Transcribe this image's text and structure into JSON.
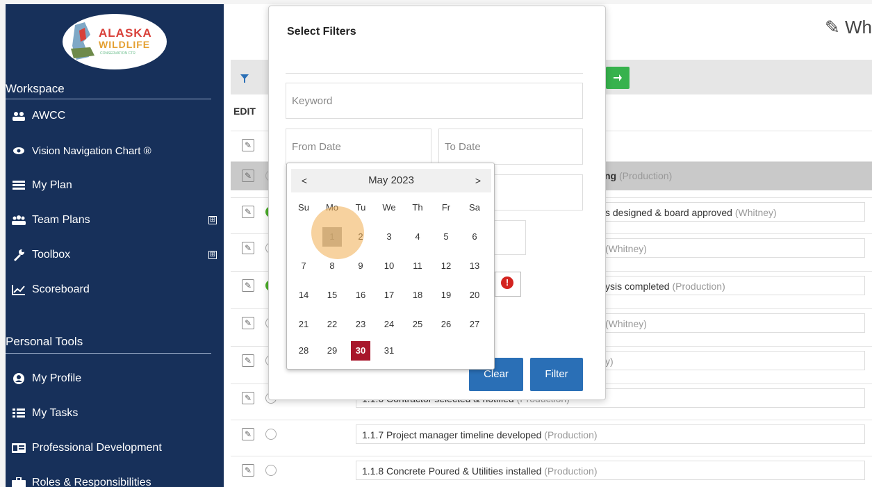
{
  "sidebar": {
    "logo": {
      "line1": "ALASKA",
      "line2": "WILDLIFE",
      "line3": "CONSERVATION CTR"
    },
    "workspace_title": "Workspace",
    "workspace_items": [
      {
        "label": "AWCC",
        "icon": "group-icon"
      },
      {
        "label": "Vision Navigation Chart ®",
        "icon": "eye-icon"
      },
      {
        "label": "My Plan",
        "icon": "list-icon"
      },
      {
        "label": "Team Plans",
        "icon": "team-icon",
        "expand": "⊞"
      },
      {
        "label": "Toolbox",
        "icon": "wrench-icon",
        "expand": "⊞"
      },
      {
        "label": "Scoreboard",
        "icon": "chart-icon"
      }
    ],
    "personal_title": "Personal Tools",
    "personal_items": [
      {
        "label": "My Profile",
        "icon": "user-circle-icon"
      },
      {
        "label": "My Tasks",
        "icon": "tasks-icon"
      },
      {
        "label": "Professional Development",
        "icon": "id-card-icon"
      },
      {
        "label": "Roles & Responsibilities",
        "icon": "briefcase-icon"
      }
    ]
  },
  "header": {
    "title": "✎ Wh"
  },
  "list": {
    "edit_header": "EDIT",
    "rows": [
      {
        "text": "ng",
        "owner": "(Production)"
      },
      {
        "text": "s designed & board approved",
        "owner": "(Whitney)"
      },
      {
        "text": "",
        "owner": "(Whitney)"
      },
      {
        "text": "ysis completed",
        "owner": "(Production)"
      },
      {
        "text": "",
        "owner": "(Whitney)"
      },
      {
        "text": "",
        "owner": "y)"
      },
      {
        "text": "1.1.6 Contractor selected & notified",
        "owner": "(Production)"
      },
      {
        "text": "1.1.7 Project manager timeline developed",
        "owner": "(Production)"
      },
      {
        "text": "1.1.8 Concrete Poured & Utilities installed",
        "owner": "(Production)"
      }
    ]
  },
  "filter_popup": {
    "title": "Select Filters",
    "keyword_placeholder": "Keyword",
    "from_date_placeholder": "From Date",
    "to_date_placeholder": "To Date",
    "clear_label": "Clear",
    "filter_label": "Filter",
    "error_glyph": "!"
  },
  "calendar": {
    "prev": "<",
    "next": ">",
    "month_label": "May 2023",
    "weekdays": [
      "Su",
      "Mo",
      "Tu",
      "We",
      "Th",
      "Fr",
      "Sa"
    ],
    "weeks": [
      [
        "",
        "1",
        "2",
        "3",
        "4",
        "5",
        "6"
      ],
      [
        "7",
        "8",
        "9",
        "10",
        "11",
        "12",
        "13"
      ],
      [
        "14",
        "15",
        "16",
        "17",
        "18",
        "19",
        "20"
      ],
      [
        "21",
        "22",
        "23",
        "24",
        "25",
        "26",
        "27"
      ],
      [
        "28",
        "29",
        "30",
        "31",
        "",
        "",
        ""
      ]
    ],
    "highlighted_day": "1",
    "selected_day": "30",
    "selected_color": "#a8162b"
  },
  "colors": {
    "sidebar": "#17305a",
    "primary": "#2a6fb6",
    "go": "#37b24d"
  }
}
